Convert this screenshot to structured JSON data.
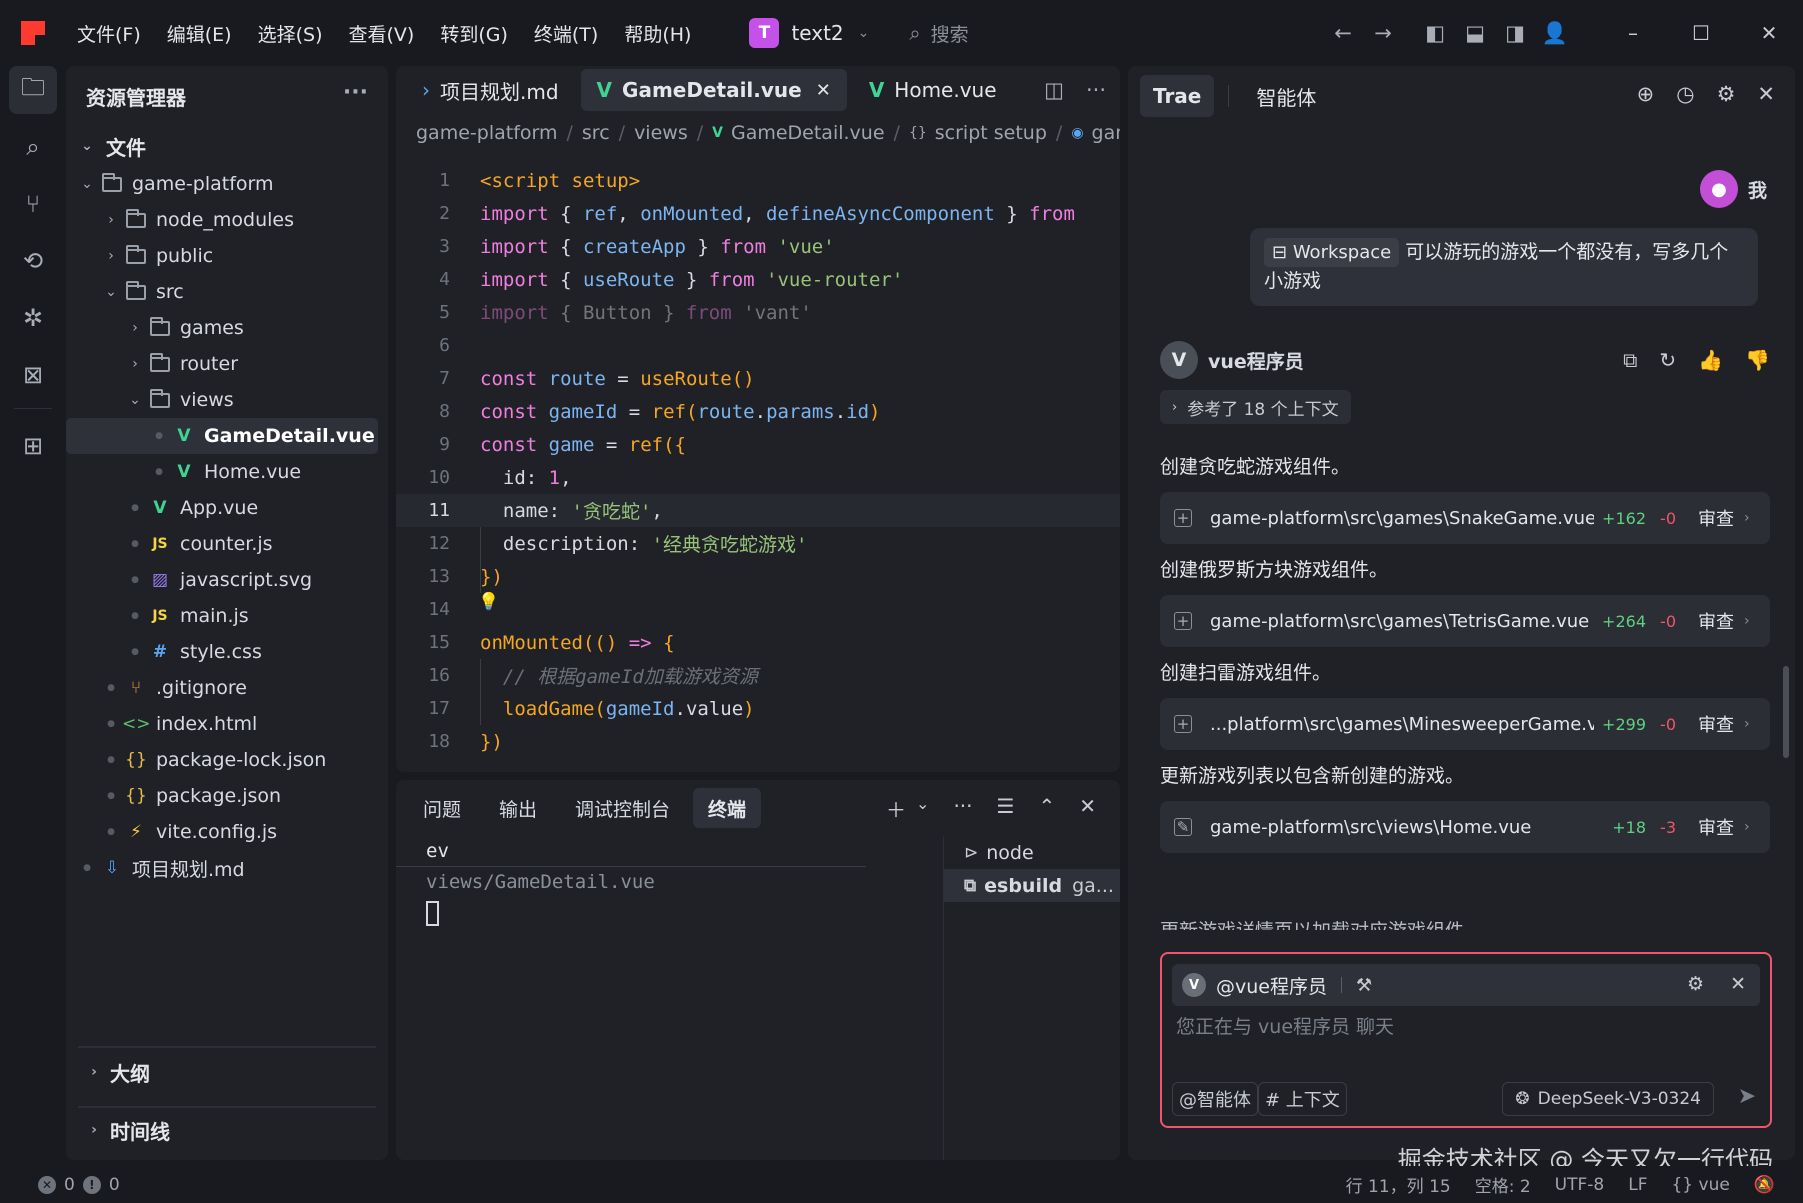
{
  "titlebar": {
    "menus": [
      "文件(F)",
      "编辑(E)",
      "选择(S)",
      "查看(V)",
      "转到(G)",
      "终端(T)",
      "帮助(H)"
    ],
    "project_badge": "T",
    "project_name": "text2",
    "search_placeholder": "搜索"
  },
  "explorer": {
    "title": "资源管理器",
    "section": "文件",
    "tree": [
      {
        "name": "game-platform",
        "depth": 0,
        "type": "folder",
        "open": true
      },
      {
        "name": "node_modules",
        "depth": 1,
        "type": "folder",
        "open": false
      },
      {
        "name": "public",
        "depth": 1,
        "type": "folder",
        "open": false
      },
      {
        "name": "src",
        "depth": 1,
        "type": "folder",
        "open": true
      },
      {
        "name": "games",
        "depth": 2,
        "type": "folder",
        "open": false
      },
      {
        "name": "router",
        "depth": 2,
        "type": "folder",
        "open": false
      },
      {
        "name": "views",
        "depth": 2,
        "type": "folder",
        "open": true
      },
      {
        "name": "GameDetail.vue",
        "depth": 3,
        "type": "vue",
        "selected": true
      },
      {
        "name": "Home.vue",
        "depth": 3,
        "type": "vue"
      },
      {
        "name": "App.vue",
        "depth": 2,
        "type": "vue"
      },
      {
        "name": "counter.js",
        "depth": 2,
        "type": "js"
      },
      {
        "name": "javascript.svg",
        "depth": 2,
        "type": "svg"
      },
      {
        "name": "main.js",
        "depth": 2,
        "type": "js"
      },
      {
        "name": "style.css",
        "depth": 2,
        "type": "css"
      },
      {
        "name": ".gitignore",
        "depth": 1,
        "type": "git"
      },
      {
        "name": "index.html",
        "depth": 1,
        "type": "html"
      },
      {
        "name": "package-lock.json",
        "depth": 1,
        "type": "json"
      },
      {
        "name": "package.json",
        "depth": 1,
        "type": "json"
      },
      {
        "name": "vite.config.js",
        "depth": 1,
        "type": "vite"
      },
      {
        "name": "项目规划.md",
        "depth": 0,
        "type": "md"
      }
    ],
    "outline": "大纲",
    "timeline": "时间线"
  },
  "editor": {
    "tabs": [
      {
        "label": "项目规划.md",
        "icon": "md",
        "active": false
      },
      {
        "label": "GameDetail.vue",
        "icon": "vue",
        "active": true
      },
      {
        "label": "Home.vue",
        "icon": "vue",
        "active": false
      }
    ],
    "breadcrumb": [
      "game-platform",
      "src",
      "views",
      "GameDetail.vue",
      "script setup",
      "game"
    ],
    "current_line": 11,
    "lines": [
      [
        [
          "tag",
          "<script setup>"
        ]
      ],
      [
        [
          "kw",
          "import"
        ],
        [
          "plain",
          " { "
        ],
        [
          "var",
          "ref"
        ],
        [
          "plain",
          ", "
        ],
        [
          "var",
          "onMounted"
        ],
        [
          "plain",
          ", "
        ],
        [
          "var",
          "defineAsyncComponent"
        ],
        [
          "plain",
          " } "
        ],
        [
          "kw",
          "from"
        ]
      ],
      [
        [
          "kw",
          "import"
        ],
        [
          "plain",
          " { "
        ],
        [
          "var",
          "createApp"
        ],
        [
          "plain",
          " } "
        ],
        [
          "kw",
          "from"
        ],
        [
          "plain",
          " "
        ],
        [
          "str",
          "'vue'"
        ]
      ],
      [
        [
          "kw",
          "import"
        ],
        [
          "plain",
          " { "
        ],
        [
          "var",
          "useRoute"
        ],
        [
          "plain",
          " } "
        ],
        [
          "kw",
          "from"
        ],
        [
          "plain",
          " "
        ],
        [
          "str",
          "'vue-router'"
        ]
      ],
      [
        [
          "dimkw",
          "import"
        ],
        [
          "dim",
          " { Button } "
        ],
        [
          "dimkw",
          "from"
        ],
        [
          "dim",
          " 'vant'"
        ]
      ],
      [],
      [
        [
          "kw",
          "const"
        ],
        [
          "plain",
          " "
        ],
        [
          "var",
          "route"
        ],
        [
          "plain",
          " = "
        ],
        [
          "fn",
          "useRoute"
        ],
        [
          "fn",
          "()"
        ]
      ],
      [
        [
          "kw",
          "const"
        ],
        [
          "plain",
          " "
        ],
        [
          "var",
          "gameId"
        ],
        [
          "plain",
          " = "
        ],
        [
          "fn",
          "ref"
        ],
        [
          "fn",
          "("
        ],
        [
          "var",
          "route"
        ],
        [
          "plain",
          "."
        ],
        [
          "var",
          "params"
        ],
        [
          "plain",
          "."
        ],
        [
          "var",
          "id"
        ],
        [
          "fn",
          ")"
        ]
      ],
      [
        [
          "kw",
          "const"
        ],
        [
          "plain",
          " "
        ],
        [
          "var",
          "game"
        ],
        [
          "plain",
          " = "
        ],
        [
          "fn",
          "ref"
        ],
        [
          "fn",
          "({"
        ]
      ],
      [
        [
          "plain",
          "  id: "
        ],
        [
          "num",
          "1"
        ],
        [
          "plain",
          ","
        ]
      ],
      [
        [
          "plain",
          "  name: "
        ],
        [
          "str",
          "'贪吃蛇'"
        ],
        [
          "plain",
          ","
        ]
      ],
      [
        [
          "plain",
          "  description: "
        ],
        [
          "str",
          "'经典贪吃蛇游戏'"
        ]
      ],
      [
        [
          "fn",
          "})"
        ]
      ],
      [],
      [
        [
          "fn",
          "onMounted"
        ],
        [
          "fn",
          "(()"
        ],
        [
          "plain",
          " "
        ],
        [
          "kw",
          "=>"
        ],
        [
          "plain",
          " "
        ],
        [
          "fn",
          "{"
        ]
      ],
      [
        [
          "cm",
          "  // 根据gameId加载游戏资源"
        ]
      ],
      [
        [
          "fn",
          "  loadGame"
        ],
        [
          "fn",
          "("
        ],
        [
          "var",
          "gameId"
        ],
        [
          "plain",
          "."
        ],
        [
          "plain",
          "value"
        ],
        [
          "fn",
          ")"
        ]
      ],
      [
        [
          "fn",
          "})"
        ]
      ]
    ]
  },
  "terminal": {
    "tabs": [
      {
        "label": "问题",
        "active": false
      },
      {
        "label": "输出",
        "active": false
      },
      {
        "label": "调试控制台",
        "active": false
      },
      {
        "label": "终端",
        "active": true
      }
    ],
    "output": [
      "ev",
      "views/GameDetail.vue"
    ],
    "sessions": [
      {
        "label": "node",
        "active": false
      },
      {
        "label": "esbuild",
        "suffix": "ga...",
        "active": true
      }
    ]
  },
  "chat": {
    "tabs": [
      {
        "label": "Trae",
        "active": true
      },
      {
        "label": "智能体",
        "active": false
      }
    ],
    "user_name": "我",
    "user_chip": "Workspace",
    "user_message": "可以游玩的游戏一个都没有，写多几个小游戏",
    "bot_avatar": "V",
    "bot_name": "vue程序员",
    "context_ref": "参考了 18 个上下文",
    "steps": [
      {
        "text": "创建贪吃蛇游戏组件。",
        "file": "game-platform\\src\\games\\SnakeGame.vue",
        "add": "+162",
        "del": "-0",
        "kind": "add"
      },
      {
        "text": "创建俄罗斯方块游戏组件。",
        "file": "game-platform\\src\\games\\TetrisGame.vue",
        "add": "+264",
        "del": "-0",
        "kind": "add"
      },
      {
        "text": "创建扫雷游戏组件。",
        "file": "...platform\\src\\games\\MinesweeperGame.vue",
        "add": "+299",
        "del": "-0",
        "kind": "add"
      },
      {
        "text": "更新游戏列表以包含新创建的游戏。",
        "file": "game-platform\\src\\views\\Home.vue",
        "add": "+18",
        "del": "-3",
        "kind": "edit"
      }
    ],
    "review_label": "审查",
    "trailing_text": "更新游戏详情页以加载对应游戏组件",
    "composer": {
      "avatar": "V",
      "agent": "@vue程序员",
      "placeholder": "您正在与 vue程序员 聊天",
      "agent_chip": "@智能体",
      "context_chip": "# 上下文",
      "model": "DeepSeek-V3-0324"
    }
  },
  "watermark": "掘金技术社区 @ 今天又欠一行代码",
  "statusbar": {
    "errors": "0",
    "warnings": "0",
    "position": "行 11，列 15",
    "spaces": "空格: 2",
    "encoding": "UTF-8",
    "eol": "LF",
    "language": "vue"
  }
}
